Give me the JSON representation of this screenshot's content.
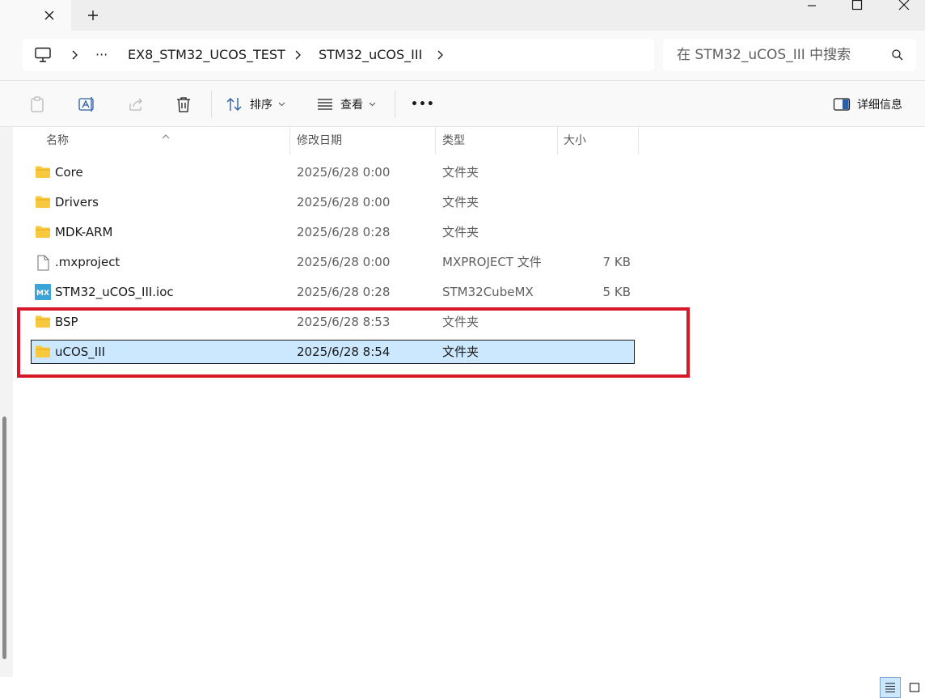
{
  "address": {
    "ellipsis": "···",
    "crumbs": [
      "EX8_STM32_UCOS_TEST",
      "STM32_uCOS_III"
    ]
  },
  "search": {
    "placeholder": "在 STM32_uCOS_III 中搜索"
  },
  "toolbar": {
    "sort_label": "排序",
    "view_label": "查看",
    "more_label": "•••",
    "details_label": "详细信息"
  },
  "columns": {
    "name": "名称",
    "date": "修改日期",
    "type": "类型",
    "size": "大小"
  },
  "files": [
    {
      "name": "Core",
      "date": "2025/6/28 0:00",
      "type": "文件夹",
      "size": "",
      "icon": "folder-icon"
    },
    {
      "name": "Drivers",
      "date": "2025/6/28 0:00",
      "type": "文件夹",
      "size": "",
      "icon": "folder-icon"
    },
    {
      "name": "MDK-ARM",
      "date": "2025/6/28 0:28",
      "type": "文件夹",
      "size": "",
      "icon": "folder-icon"
    },
    {
      "name": ".mxproject",
      "date": "2025/6/28 0:00",
      "type": "MXPROJECT 文件",
      "size": "7 KB",
      "icon": "file-icon"
    },
    {
      "name": "STM32_uCOS_III.ioc",
      "date": "2025/6/28 0:28",
      "type": "STM32CubeMX",
      "size": "5 KB",
      "icon": "stm32cubemx-icon"
    },
    {
      "name": "BSP",
      "date": "2025/6/28 8:53",
      "type": "文件夹",
      "size": "",
      "icon": "folder-icon"
    },
    {
      "name": "uCOS_III",
      "date": "2025/6/28 8:54",
      "type": "文件夹",
      "size": "",
      "icon": "folder-icon",
      "selected": true
    }
  ],
  "icons": {
    "mx_badge": "MX"
  },
  "colors": {
    "selection": "#cce8ff",
    "highlight_box": "#d7182a",
    "folder": "#f8c83f"
  }
}
